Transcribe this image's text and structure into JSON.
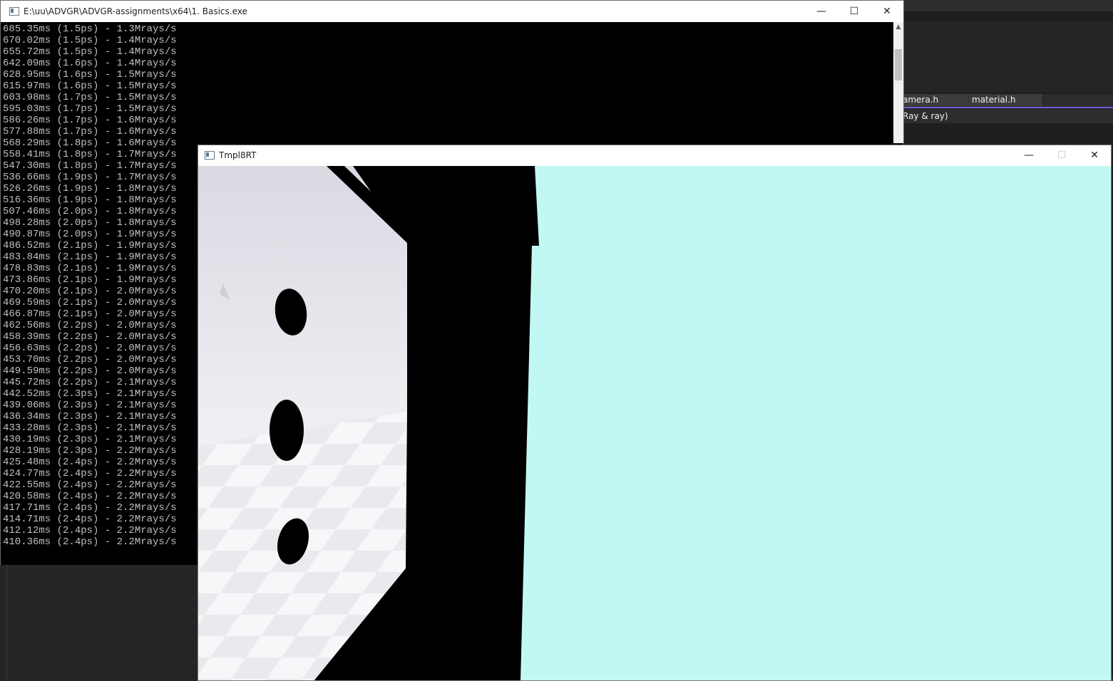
{
  "ide": {
    "tabs": [
      "amera.h",
      "material.h"
    ],
    "signature_fragment": "Ray & ray)",
    "accent_color": "#6f5fd8"
  },
  "console": {
    "title": "E:\\uu\\ADVGR\\ADVGR-assignments\\x64\\1. Basics.exe",
    "icon": "console-app-icon",
    "lines": [
      "685.35ms (1.5ps) - 1.3Mrays/s",
      "670.02ms (1.5ps) - 1.4Mrays/s",
      "655.72ms (1.5ps) - 1.4Mrays/s",
      "642.09ms (1.6ps) - 1.4Mrays/s",
      "628.95ms (1.6ps) - 1.5Mrays/s",
      "615.97ms (1.6ps) - 1.5Mrays/s",
      "603.98ms (1.7ps) - 1.5Mrays/s",
      "595.03ms (1.7ps) - 1.5Mrays/s",
      "586.26ms (1.7ps) - 1.6Mrays/s",
      "577.88ms (1.7ps) - 1.6Mrays/s",
      "568.29ms (1.8ps) - 1.6Mrays/s",
      "558.41ms (1.8ps) - 1.7Mrays/s",
      "547.30ms (1.8ps) - 1.7Mrays/s",
      "536.66ms (1.9ps) - 1.7Mrays/s",
      "526.26ms (1.9ps) - 1.8Mrays/s",
      "516.36ms (1.9ps) - 1.8Mrays/s",
      "507.46ms (2.0ps) - 1.8Mrays/s",
      "498.28ms (2.0ps) - 1.8Mrays/s",
      "490.87ms (2.0ps) - 1.9Mrays/s",
      "486.52ms (2.1ps) - 1.9Mrays/s",
      "483.84ms (2.1ps) - 1.9Mrays/s",
      "478.83ms (2.1ps) - 1.9Mrays/s",
      "473.86ms (2.1ps) - 1.9Mrays/s",
      "470.20ms (2.1ps) - 2.0Mrays/s",
      "469.59ms (2.1ps) - 2.0Mrays/s",
      "466.87ms (2.1ps) - 2.0Mrays/s",
      "462.56ms (2.2ps) - 2.0Mrays/s",
      "458.39ms (2.2ps) - 2.0Mrays/s",
      "456.63ms (2.2ps) - 2.0Mrays/s",
      "453.70ms (2.2ps) - 2.0Mrays/s",
      "449.59ms (2.2ps) - 2.0Mrays/s",
      "445.72ms (2.2ps) - 2.1Mrays/s",
      "442.52ms (2.3ps) - 2.1Mrays/s",
      "439.06ms (2.3ps) - 2.1Mrays/s",
      "436.34ms (2.3ps) - 2.1Mrays/s",
      "433.28ms (2.3ps) - 2.1Mrays/s",
      "430.19ms (2.3ps) - 2.1Mrays/s",
      "428.19ms (2.3ps) - 2.2Mrays/s",
      "425.48ms (2.4ps) - 2.2Mrays/s",
      "424.77ms (2.4ps) - 2.2Mrays/s",
      "422.55ms (2.4ps) - 2.2Mrays/s",
      "420.58ms (2.4ps) - 2.2Mrays/s",
      "417.71ms (2.4ps) - 2.2Mrays/s",
      "414.71ms (2.4ps) - 2.2Mrays/s",
      "412.12ms (2.4ps) - 2.2Mrays/s",
      "410.36ms (2.4ps) - 2.2Mrays/s"
    ]
  },
  "render_window": {
    "title": "Tmpl8RT",
    "icon": "app-window-icon",
    "sky_color": "#c2f8f4",
    "wall_color": "#e4e4ec",
    "floor_light": "#f7f7f9",
    "floor_dark": "#eaeaee",
    "shadow_color": "#000000"
  },
  "window_controls": {
    "minimize": "—",
    "maximize": "☐",
    "close": "✕"
  }
}
